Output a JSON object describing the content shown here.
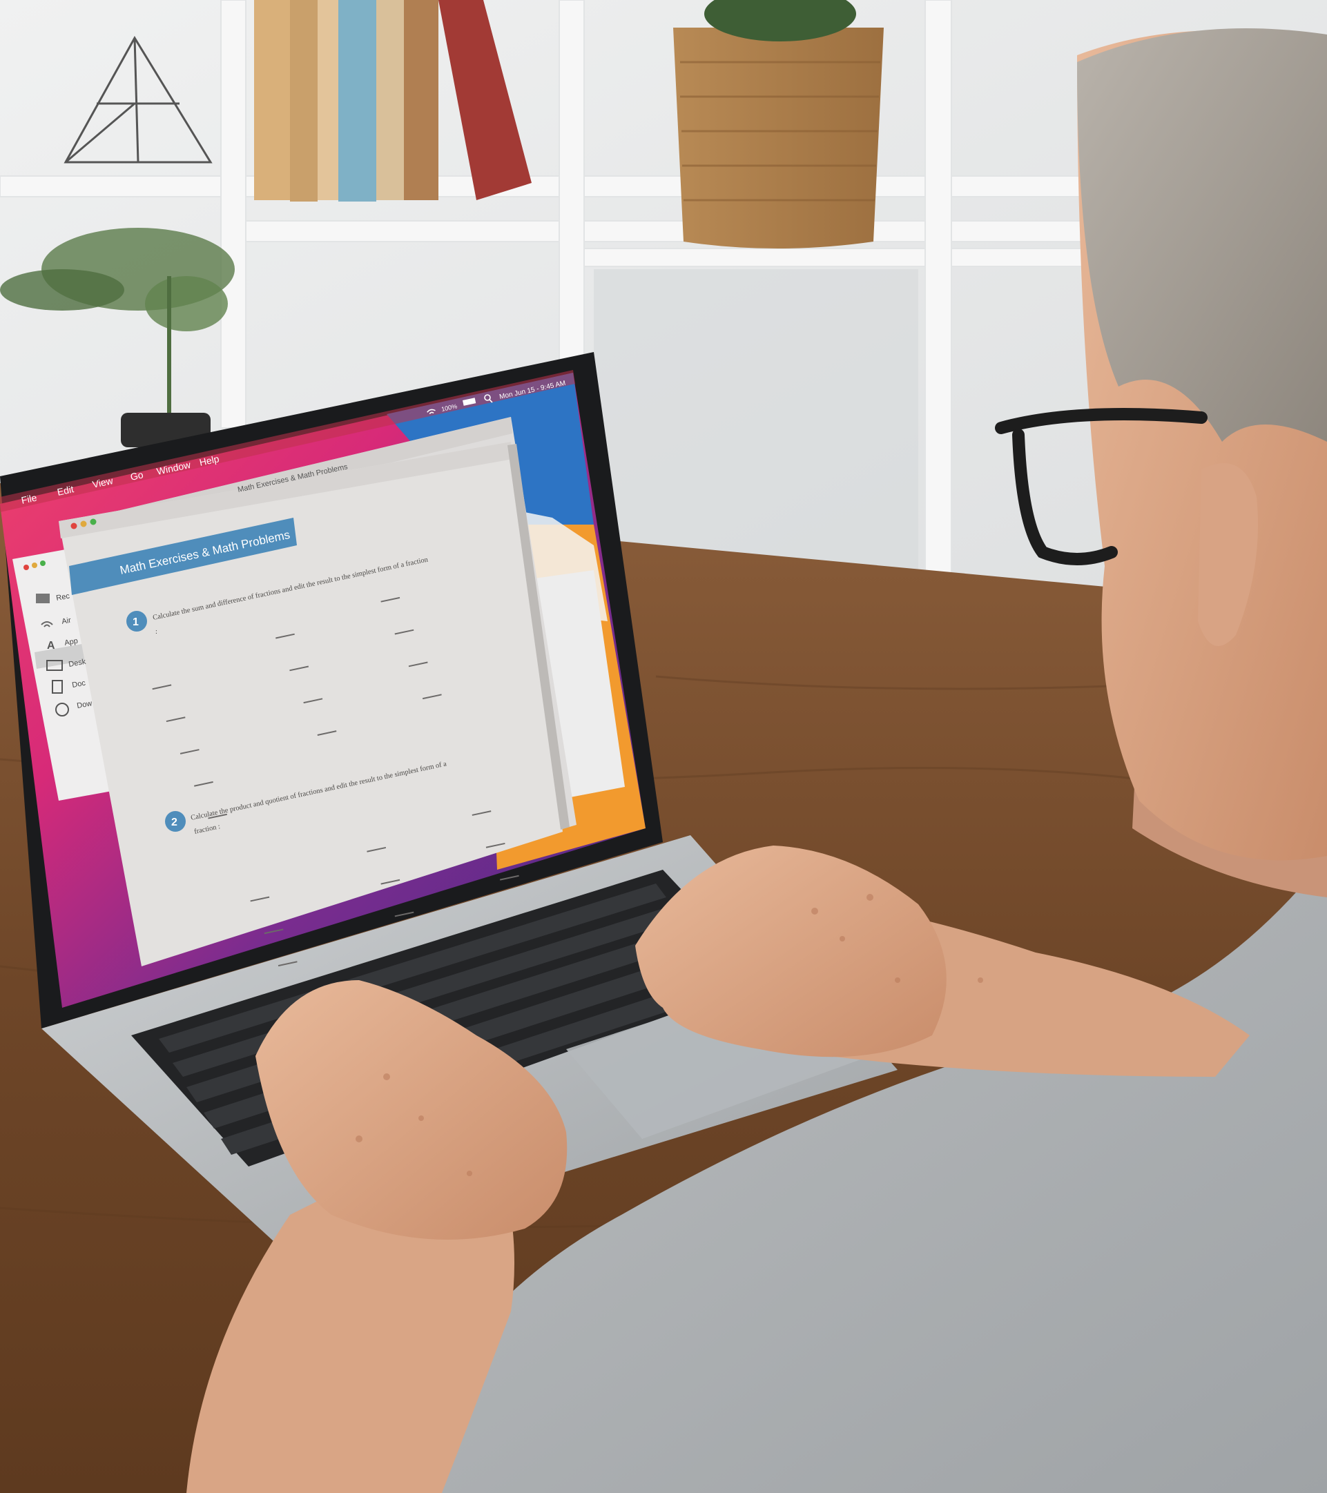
{
  "menubar": {
    "items": [
      "File",
      "Edit",
      "View",
      "Go",
      "Window",
      "Help"
    ],
    "battery": "100%",
    "datetime": "Mon Jun 15 - 9:45 AM"
  },
  "finder": {
    "sidebar": [
      "Rec",
      "Air",
      "App",
      "Desk",
      "Doc",
      "Dow"
    ]
  },
  "document": {
    "window_title": "Math Exercises & Math Problems",
    "banner": "Math Exercises & Math Problems",
    "exercise1": {
      "number": "1",
      "instruction": "Calculate the sum and difference of fractions and edit the result to the simplest form of a fraction",
      "colon": ":"
    },
    "exercise2": {
      "number": "2",
      "instruction": "Calculate the product and quotient of fractions and edit the result to the simplest form of a",
      "instruction_cont": "fraction :"
    }
  },
  "colors": {
    "banner": "#4f8dbb",
    "wallpaper_pink": "#e8336f",
    "wallpaper_purple": "#7a2c8f",
    "wallpaper_orange": "#f29a2e",
    "wallpaper_blue": "#2d74c4",
    "desk": "#7a4f2f"
  }
}
